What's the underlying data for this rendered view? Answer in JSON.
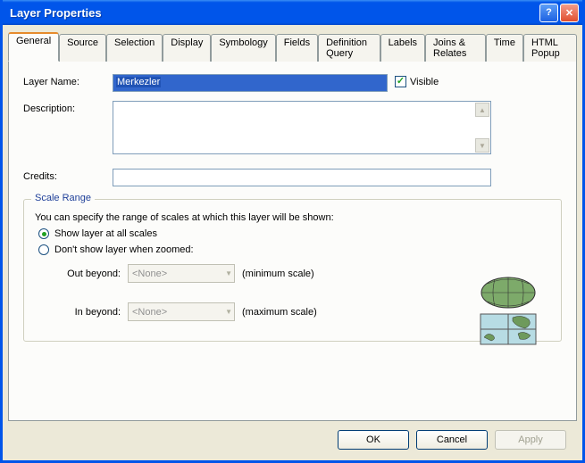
{
  "window": {
    "title": "Layer Properties"
  },
  "tabs": [
    "General",
    "Source",
    "Selection",
    "Display",
    "Symbology",
    "Fields",
    "Definition Query",
    "Labels",
    "Joins & Relates",
    "Time",
    "HTML Popup"
  ],
  "general": {
    "layerNameLabel": "Layer Name:",
    "layerNameValue": "Merkezler",
    "visibleLabel": "Visible",
    "visibleChecked": true,
    "descriptionLabel": "Description:",
    "descriptionValue": "",
    "creditsLabel": "Credits:",
    "creditsValue": ""
  },
  "scaleRange": {
    "legend": "Scale Range",
    "intro": "You can specify the range of scales at which this layer will be shown:",
    "opt1": "Show layer at all scales",
    "opt2": "Don't show layer when zoomed:",
    "selected": "opt1",
    "outBeyondLabel": "Out beyond:",
    "outBeyondValue": "<None>",
    "outBeyondHint": "(minimum scale)",
    "inBeyondLabel": "In beyond:",
    "inBeyondValue": "<None>",
    "inBeyondHint": "(maximum scale)"
  },
  "buttons": {
    "ok": "OK",
    "cancel": "Cancel",
    "apply": "Apply"
  }
}
